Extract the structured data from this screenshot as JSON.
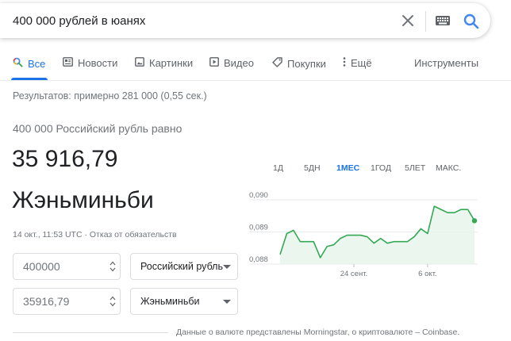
{
  "search": {
    "query": "400 000 рублей в юанях"
  },
  "tabs": [
    {
      "label": "Все",
      "icon": "search-icon",
      "active": true
    },
    {
      "label": "Новости",
      "icon": "news-icon"
    },
    {
      "label": "Картинки",
      "icon": "image-icon"
    },
    {
      "label": "Видео",
      "icon": "video-play-icon"
    },
    {
      "label": "Покупки",
      "icon": "tag-icon"
    },
    {
      "label": "Ещё",
      "icon": "more-vert-icon"
    }
  ],
  "tools_label": "Инструменты",
  "result_stats": "Результатов: примерно 281 000 (0,55 сек.)",
  "converter": {
    "label": "400 000 Российский рубль равно",
    "value": "35 916,79",
    "currency": "Жэньминьби",
    "timestamp": "14 окт., 11:53 UTC",
    "separator": "·",
    "disclaimer": "Отказ от обязательств",
    "from_amount": "400000",
    "from_currency": "Российский рубль",
    "to_amount": "35916,79",
    "to_currency": "Жэньминьби"
  },
  "ranges": [
    {
      "label": "1Д"
    },
    {
      "label": "5ДН"
    },
    {
      "label": "1МЕС",
      "active": true
    },
    {
      "label": "1ГОД"
    },
    {
      "label": "5ЛЕТ"
    },
    {
      "label": "МАКС."
    }
  ],
  "colors": {
    "accent": "#1a73e8",
    "chart_line": "#34a853",
    "chart_fill": "#e6f4ea"
  },
  "chart_data": {
    "type": "area",
    "y_ticks": [
      "0,090",
      "0,089",
      "0,088"
    ],
    "ylim": [
      0.088,
      0.09
    ],
    "x_ticks": [
      {
        "label": "24 сент.",
        "index": 11
      },
      {
        "label": "6 окт.",
        "index": 22
      }
    ],
    "values": [
      0.0883,
      0.08895,
      0.08905,
      0.0887,
      0.0887,
      0.0887,
      0.0882,
      0.08855,
      0.0886,
      0.0888,
      0.0889,
      0.0889,
      0.0889,
      0.08885,
      0.08865,
      0.0888,
      0.08865,
      0.0887,
      0.0887,
      0.0887,
      0.08885,
      0.0891,
      0.08895,
      0.0898,
      0.0897,
      0.0896,
      0.0896,
      0.0897,
      0.0897,
      0.08935
    ]
  },
  "footer": "Данные о валюте представлены Morningstar, о криптовалюте – Coinbase."
}
